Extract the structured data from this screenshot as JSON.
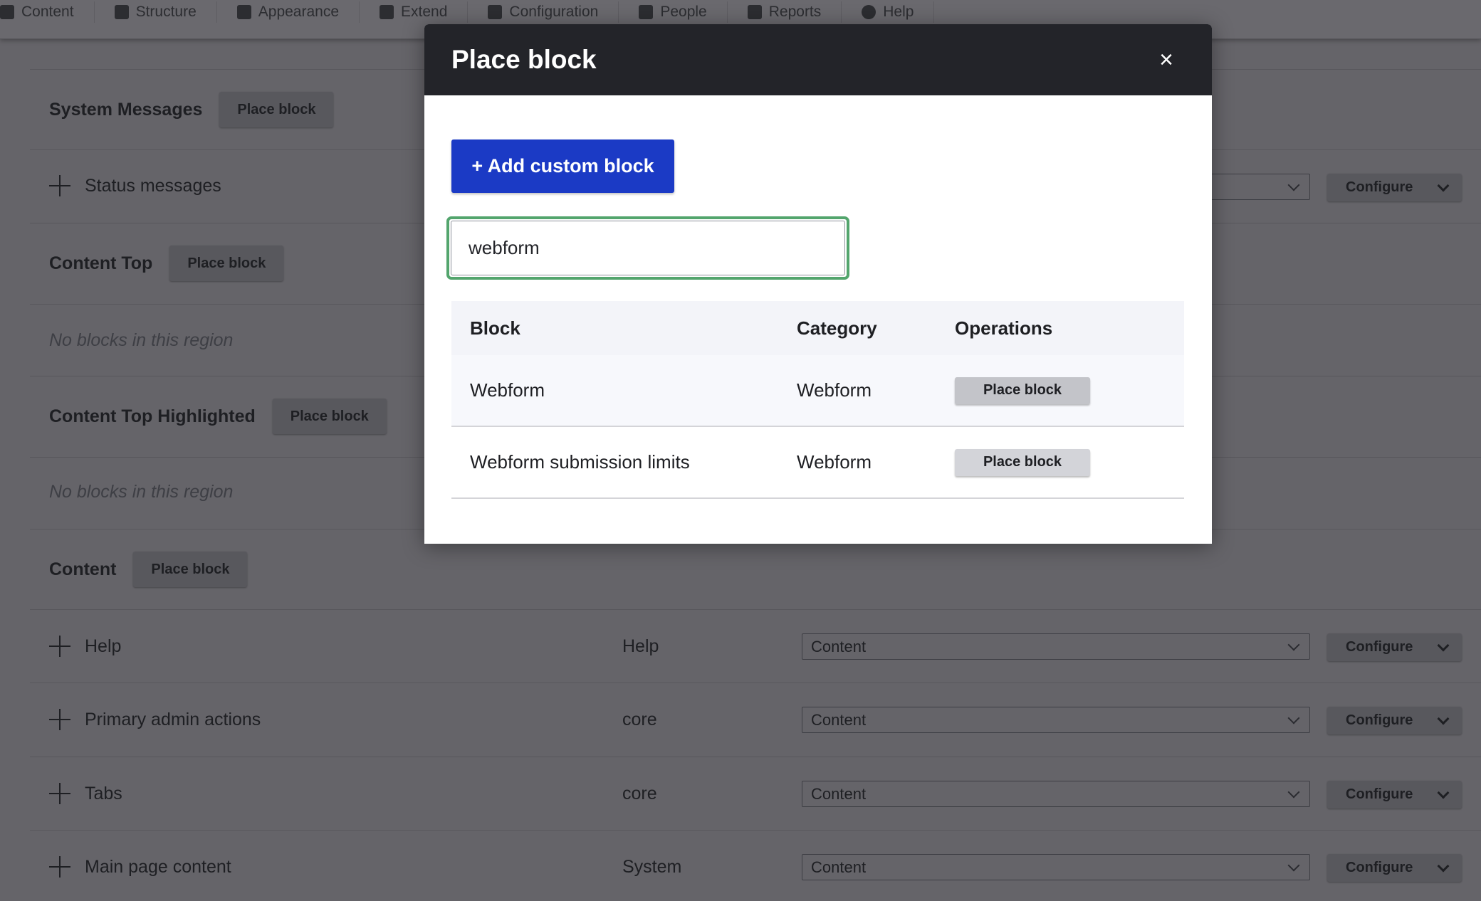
{
  "nav": {
    "items": [
      {
        "label": "Content",
        "icon": "content-icon"
      },
      {
        "label": "Structure",
        "icon": "structure-icon"
      },
      {
        "label": "Appearance",
        "icon": "appearance-icon"
      },
      {
        "label": "Extend",
        "icon": "extend-icon"
      },
      {
        "label": "Configuration",
        "icon": "wrench-icon"
      },
      {
        "label": "People",
        "icon": "people-icon"
      },
      {
        "label": "Reports",
        "icon": "reports-icon"
      },
      {
        "label": "Help",
        "icon": "help-icon"
      }
    ]
  },
  "regions": [
    {
      "name": "System Messages",
      "button": "Place block"
    },
    {
      "name": "Content Top",
      "button": "Place block"
    },
    {
      "name": "Content Top Highlighted",
      "button": "Place block"
    },
    {
      "name": "Content",
      "button": "Place block"
    }
  ],
  "empty_text": "No blocks in this region",
  "blocks": [
    {
      "label": "Status messages",
      "category": "",
      "region": "",
      "configure": "Configure"
    },
    {
      "label": "Help",
      "category": "Help",
      "region": "Content",
      "configure": "Configure"
    },
    {
      "label": "Primary admin actions",
      "category": "core",
      "region": "Content",
      "configure": "Configure"
    },
    {
      "label": "Tabs",
      "category": "core",
      "region": "Content",
      "configure": "Configure"
    },
    {
      "label": "Main page content",
      "category": "System",
      "region": "Content",
      "configure": "Configure"
    }
  ],
  "dialog": {
    "title": "Place block",
    "close": "×",
    "add_button": "+ Add custom block",
    "search_value": "webform",
    "table": {
      "headers": [
        "Block",
        "Category",
        "Operations"
      ],
      "rows": [
        {
          "block": "Webform",
          "category": "Webform",
          "op": "Place block"
        },
        {
          "block": "Webform submission limits",
          "category": "Webform",
          "op": "Place block"
        }
      ]
    }
  },
  "colors": {
    "accent": "#1b3ac5",
    "focus": "#53a56d",
    "dialog_header": "#232429"
  }
}
